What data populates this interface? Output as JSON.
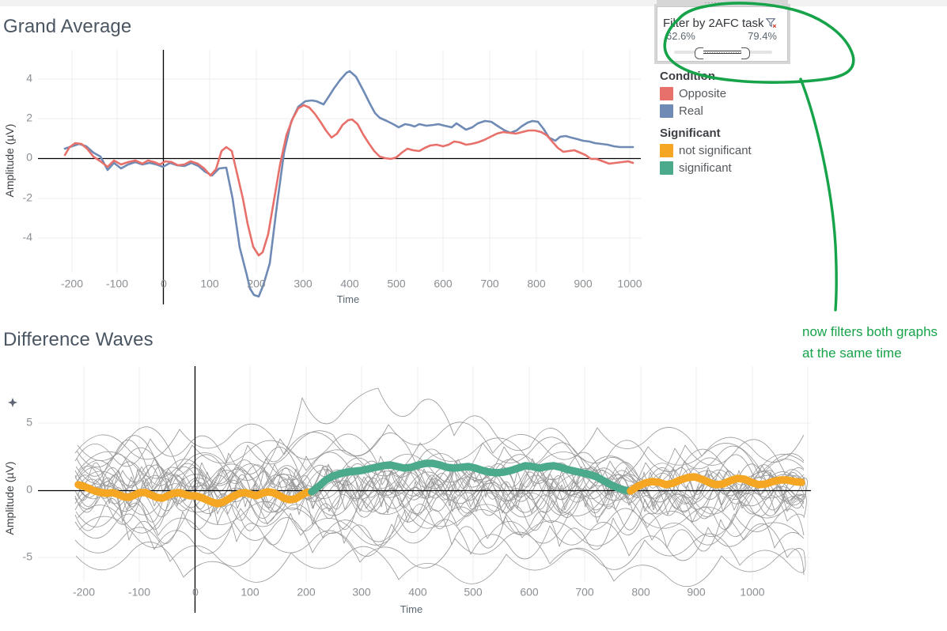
{
  "page": {
    "background": "#ffffff",
    "top_band_color": "#f2f2f2"
  },
  "charts": [
    {
      "id": "grand-average",
      "title": "Grand Average"
    },
    {
      "id": "difference-waves",
      "title": "Difference Waves"
    }
  ],
  "legend": {
    "groups": [
      {
        "title": "Condition",
        "items": [
          {
            "label": "Opposite",
            "color": "#e8706b"
          },
          {
            "label": "Real",
            "color": "#6e8ab5"
          }
        ]
      },
      {
        "title": "Significant",
        "items": [
          {
            "label": "not significant",
            "color": "#f5a623"
          },
          {
            "label": "significant",
            "color": "#4ba98c"
          }
        ]
      }
    ]
  },
  "filter_card": {
    "title": "Filter by 2AFC task",
    "filter_icon": "filter-remove-icon",
    "drag_handle_icon": "drag-handle-icon",
    "collapse_icon": "chevron-down-icon",
    "expand_icon": "chevron-up-icon",
    "min_value": "62.6%",
    "max_value": "79.4%",
    "slider": {
      "handle_left_label": "62.6%",
      "handle_right_label": "79.4%"
    }
  },
  "annotation": {
    "color": "#16a34a",
    "text": "now filters both graphs at the same time"
  },
  "chart_data": [
    {
      "type": "line",
      "title": "Grand Average",
      "xlabel": "Time",
      "ylabel": "Amplitude (µV)",
      "xlim": [
        -220,
        1010
      ],
      "ylim": [
        -5.6,
        5.4
      ],
      "xticks": [
        -200,
        -100,
        0,
        100,
        200,
        300,
        400,
        500,
        600,
        700,
        800,
        900,
        1000
      ],
      "yticks": [
        -4,
        -2,
        0,
        2,
        4
      ],
      "grid": true,
      "legend_position": "right",
      "zero_lines": [
        "x=0",
        "y=0"
      ],
      "x": [
        -210,
        -195,
        -180,
        -165,
        -150,
        -135,
        -120,
        -105,
        -90,
        -75,
        -60,
        -45,
        -30,
        -15,
        0,
        15,
        30,
        45,
        60,
        75,
        90,
        105,
        120,
        135,
        150,
        165,
        180,
        195,
        210,
        225,
        240,
        255,
        270,
        285,
        300,
        315,
        330,
        345,
        360,
        375,
        390,
        405,
        420,
        435,
        450,
        465,
        480,
        495,
        510,
        525,
        540,
        555,
        570,
        585,
        600,
        615,
        630,
        645,
        660,
        675,
        690,
        705,
        720,
        735,
        750,
        765,
        780,
        795,
        810,
        825,
        840,
        855,
        870,
        885,
        900,
        915,
        930,
        945,
        960,
        975,
        990,
        1000
      ],
      "series": [
        {
          "name": "Opposite",
          "color": "#e8706b",
          "values": [
            0.3,
            0.55,
            0.7,
            0.62,
            0.4,
            0.1,
            -0.22,
            -0.3,
            -0.25,
            -0.28,
            -0.32,
            -0.25,
            -0.33,
            -0.25,
            -0.2,
            -0.35,
            -0.28,
            -0.2,
            -0.3,
            -0.42,
            -0.55,
            -0.3,
            0.2,
            0.48,
            0.2,
            -0.6,
            -1.6,
            -2.9,
            -4.1,
            -4.7,
            -4.5,
            -3.4,
            -1.6,
            0.6,
            2.4,
            3.35,
            3.55,
            3.2,
            2.55,
            2.12,
            1.75,
            1.45,
            1.9,
            2.62,
            3.22,
            3.05,
            2.4,
            1.6,
            0.8,
            0.2,
            0.0,
            0.05,
            0.35,
            0.65,
            0.95,
            0.8,
            0.72,
            0.9,
            1.15,
            1.4,
            1.18,
            0.9,
            0.85,
            0.95,
            0.9,
            1.0,
            1.15,
            1.3,
            1.42,
            1.4,
            1.32,
            1.45,
            1.52,
            1.55,
            1.42,
            1.2,
            0.85,
            0.6,
            0.7,
            0.5,
            0.2,
            -0.1,
            -0.22
          ]
        },
        {
          "name": "Real",
          "color": "#6e8ab5",
          "values": [
            0.45,
            0.6,
            0.68,
            0.58,
            0.35,
            0.05,
            -0.3,
            -0.4,
            -0.3,
            -0.3,
            -0.35,
            -0.28,
            -0.4,
            -0.3,
            -0.22,
            -0.45,
            -0.38,
            -0.28,
            -0.4,
            -0.52,
            -0.6,
            -0.35,
            -0.1,
            -0.1,
            -0.9,
            -1.9,
            -3.2,
            -4.3,
            -4.9,
            -4.95,
            -4.3,
            -2.9,
            -1.0,
            1.2,
            2.6,
            3.05,
            3.2,
            3.1,
            2.9,
            3.1,
            3.7,
            4.4,
            4.85,
            5.0,
            4.75,
            4.05,
            3.3,
            2.85,
            2.6,
            2.5,
            2.35,
            2.5,
            2.48,
            2.42,
            2.5,
            2.4,
            2.45,
            2.42,
            2.35,
            2.52,
            2.3,
            2.18,
            2.3,
            2.48,
            2.45,
            2.3,
            2.12,
            2.22,
            2.45,
            2.55,
            2.52,
            2.3,
            1.9,
            1.58,
            1.62,
            1.55,
            1.45,
            1.3,
            1.1,
            1.0,
            0.92,
            0.9
          ]
        }
      ]
    },
    {
      "type": "line",
      "title": "Difference Waves",
      "xlabel": "Time",
      "ylabel": "Amplitude (µV)",
      "ylabel_icon": "sort-icon",
      "xlim": [
        -225,
        1010
      ],
      "ylim": [
        -7.6,
        9.2
      ],
      "xticks": [
        -200,
        -100,
        0,
        100,
        200,
        300,
        400,
        500,
        600,
        700,
        800,
        900,
        1000
      ],
      "yticks": [
        -5,
        0,
        5
      ],
      "grid": true,
      "zero_lines": [
        "x=0",
        "y=0"
      ],
      "background_series_note": "~30 individual subject difference waves drawn in thin grey",
      "background_series_count": 30,
      "background_color": "#808080",
      "x": [
        -210,
        -190,
        -170,
        -150,
        -130,
        -110,
        -90,
        -70,
        -50,
        -30,
        -10,
        10,
        30,
        50,
        70,
        90,
        110,
        130,
        150,
        170,
        190,
        210,
        230,
        250,
        270,
        290,
        310,
        330,
        350,
        370,
        390,
        410,
        430,
        450,
        470,
        490,
        510,
        530,
        550,
        570,
        590,
        610,
        630,
        650,
        670,
        690,
        710,
        730,
        750,
        770,
        790,
        810,
        830,
        850,
        870,
        890,
        910,
        930,
        950,
        970,
        990,
        1000
      ],
      "series": [
        {
          "name": "mean difference wave",
          "values": [
            0.45,
            0.3,
            0.1,
            0.0,
            -0.18,
            -0.05,
            0.05,
            -0.1,
            -0.2,
            -0.1,
            0.05,
            -0.05,
            -0.18,
            -0.3,
            -0.45,
            -0.52,
            -0.4,
            -0.22,
            -0.08,
            0.1,
            0.0,
            -0.25,
            -0.35,
            -0.25,
            0.05,
            0.4,
            0.7,
            0.85,
            0.95,
            1.05,
            1.18,
            1.1,
            1.15,
            1.25,
            1.2,
            1.1,
            1.05,
            1.1,
            1.0,
            0.85,
            0.8,
            0.95,
            1.15,
            1.05,
            1.15,
            1.05,
            0.95,
            0.88,
            0.8,
            0.55,
            0.35,
            0.3,
            0.42,
            0.55,
            0.45,
            0.3,
            0.45,
            0.6,
            0.5,
            0.42,
            0.55,
            0.5
          ],
          "segments": [
            {
              "significance": "not significant",
              "color": "#f5a623",
              "x_start": -210,
              "x_end": 318
            },
            {
              "significance": "significant",
              "color": "#4ba98c",
              "x_start": 318,
              "x_end": 792
            },
            {
              "significance": "not significant",
              "color": "#f5a623",
              "x_start": 792,
              "x_end": 1000
            }
          ]
        }
      ]
    }
  ]
}
